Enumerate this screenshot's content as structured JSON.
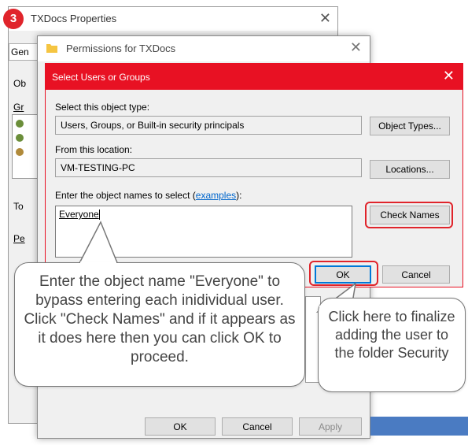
{
  "step_badge": "3",
  "properties_window": {
    "title": "TXDocs Properties",
    "tab_stub": "Gen",
    "stubs": [
      "Ob",
      "Gr",
      "To",
      "Pe"
    ]
  },
  "permissions_window": {
    "title": "Permissions for TXDocs",
    "buttons": {
      "ok": "OK",
      "cancel": "Cancel",
      "apply": "Apply"
    }
  },
  "select_dialog": {
    "title": "Select Users or Groups",
    "object_type_label": "Select this object type:",
    "object_type_value": "Users, Groups, or Built-in security principals",
    "object_types_button": "Object Types...",
    "location_label": "From this location:",
    "location_value": "VM-TESTING-PC",
    "locations_button": "Locations...",
    "enter_names_label": "Enter the object names to select (",
    "examples_link": "examples",
    "enter_names_suffix": "):",
    "names_value": "Everyone",
    "check_names_button": "Check Names",
    "ok_button": "OK",
    "cancel_button": "Cancel"
  },
  "callouts": {
    "left": "Enter the object name \"Everyone\" to bypass entering each inidividual user.  Click \"Check Names\" and if it appears as it does here then you can click OK to proceed.",
    "right": "Click here to finalize adding the user to the folder Security"
  },
  "colors": {
    "accent_red": "#e81123",
    "highlight_red": "#e0242b",
    "link_blue": "#0066cc"
  }
}
